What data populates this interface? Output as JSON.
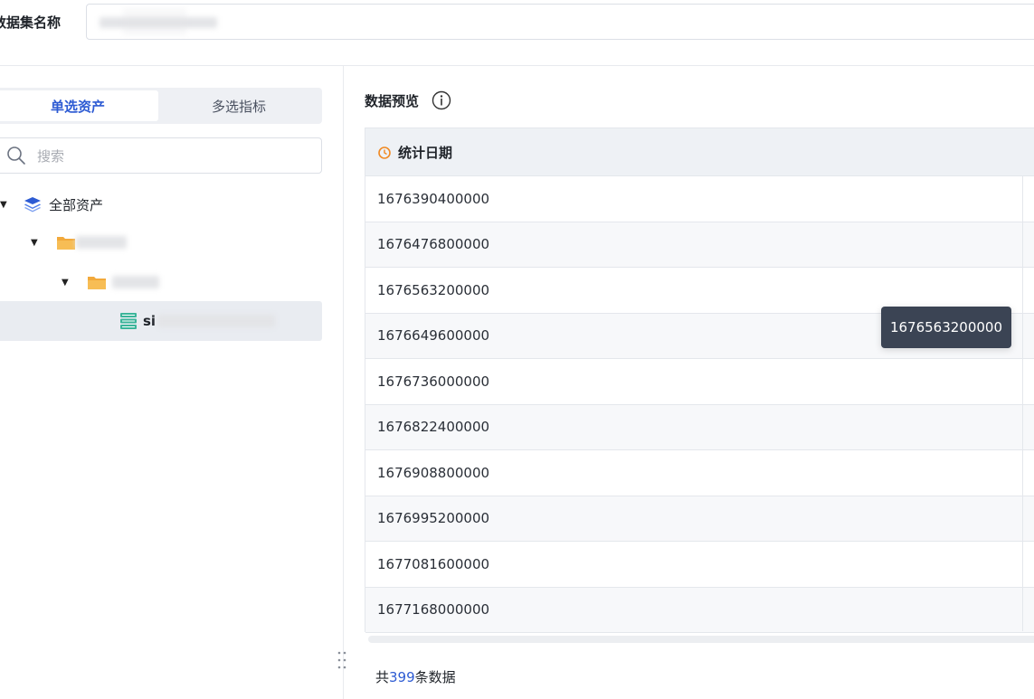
{
  "header": {
    "dataset_name_label": "数据集名称",
    "dataset_name_value": ""
  },
  "left_panel": {
    "tabs": [
      {
        "label": "单选资产",
        "active": true
      },
      {
        "label": "多选指标",
        "active": false
      }
    ],
    "search": {
      "placeholder": "搜索",
      "value": ""
    },
    "tree": {
      "root_label": "全部资产",
      "root_icon": "layers-icon",
      "folder_icon": "folder-icon",
      "table_icon": "table-icon",
      "level2_label": "",
      "level3_label": "",
      "leaf_label_prefix": "si"
    }
  },
  "preview": {
    "title": "数据预览",
    "info_icon": "info-circle-icon",
    "column_icon": "clock-icon",
    "column_header": "统计日期",
    "rows": [
      "1676390400000",
      "1676476800000",
      "1676563200000",
      "1676649600000",
      "1676736000000",
      "1676822400000",
      "1676908800000",
      "1676995200000",
      "1677081600000",
      "1677168000000"
    ],
    "tooltip": "1676563200000",
    "count_prefix": "共",
    "count_value": "399",
    "count_suffix": "条数据"
  },
  "colors": {
    "accent": "#2d5bd3",
    "folder": "#f2a93b",
    "table_icon": "#3bb59a",
    "clock_icon": "#f08a24",
    "tooltip_bg": "#3b4454"
  }
}
